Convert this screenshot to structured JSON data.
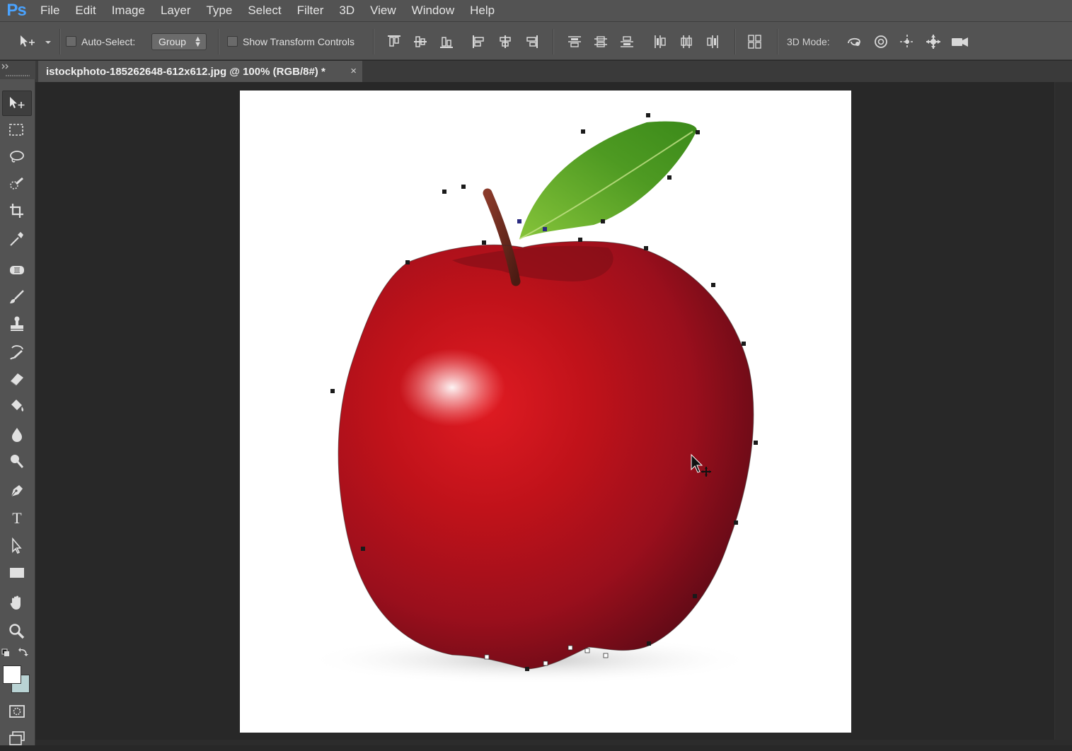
{
  "app": {
    "logo": "Ps"
  },
  "menu": [
    "File",
    "Edit",
    "Image",
    "Layer",
    "Type",
    "Select",
    "Filter",
    "3D",
    "View",
    "Window",
    "Help"
  ],
  "options": {
    "move_tool_icon": "move-arrow-icon",
    "auto_select_label": "Auto-Select:",
    "auto_select_checked": false,
    "auto_select_value": "Group",
    "show_transform_label": "Show Transform Controls",
    "show_transform_checked": false,
    "mode_3d_label": "3D Mode:"
  },
  "document": {
    "tab_title": "istockphoto-185262648-612x612.jpg @ 100% (RGB/8#) *",
    "close_glyph": "×",
    "zoom_percent": 100,
    "color_mode": "RGB/8#"
  },
  "tools": [
    {
      "name": "move-tool",
      "icon": "move-arrow-icon",
      "active": true
    },
    {
      "name": "rectangular-marquee-tool",
      "icon": "dashed-rect-icon"
    },
    {
      "name": "lasso-tool",
      "icon": "lasso-icon"
    },
    {
      "name": "quick-selection-tool",
      "icon": "quick-selection-brush-icon"
    },
    {
      "name": "crop-tool",
      "icon": "crop-icon"
    },
    {
      "name": "eyedropper-tool",
      "icon": "eyedropper-icon"
    },
    {
      "name": "healing-brush-tool",
      "icon": "bandage-icon"
    },
    {
      "name": "brush-tool",
      "icon": "brush-icon"
    },
    {
      "name": "clone-stamp-tool",
      "icon": "stamp-icon"
    },
    {
      "name": "history-brush-tool",
      "icon": "history-brush-icon"
    },
    {
      "name": "eraser-tool",
      "icon": "eraser-icon"
    },
    {
      "name": "paint-bucket-tool",
      "icon": "paint-bucket-icon"
    },
    {
      "name": "blur-tool",
      "icon": "water-drop-icon"
    },
    {
      "name": "dodge-tool",
      "icon": "dodge-icon"
    },
    {
      "name": "pen-tool",
      "icon": "pen-nib-icon"
    },
    {
      "name": "type-tool",
      "icon": "type-t-icon"
    },
    {
      "name": "path-selection-tool",
      "icon": "path-arrow-icon"
    },
    {
      "name": "rectangle-tool",
      "icon": "rectangle-shape-icon"
    },
    {
      "name": "hand-tool",
      "icon": "hand-icon"
    },
    {
      "name": "zoom-tool",
      "icon": "magnifier-icon"
    }
  ],
  "colors": {
    "foreground": "#ffffff",
    "background": "#b9d3d4",
    "accent": "#4aa3ff",
    "panel": "#535353",
    "workspace": "#282828"
  }
}
